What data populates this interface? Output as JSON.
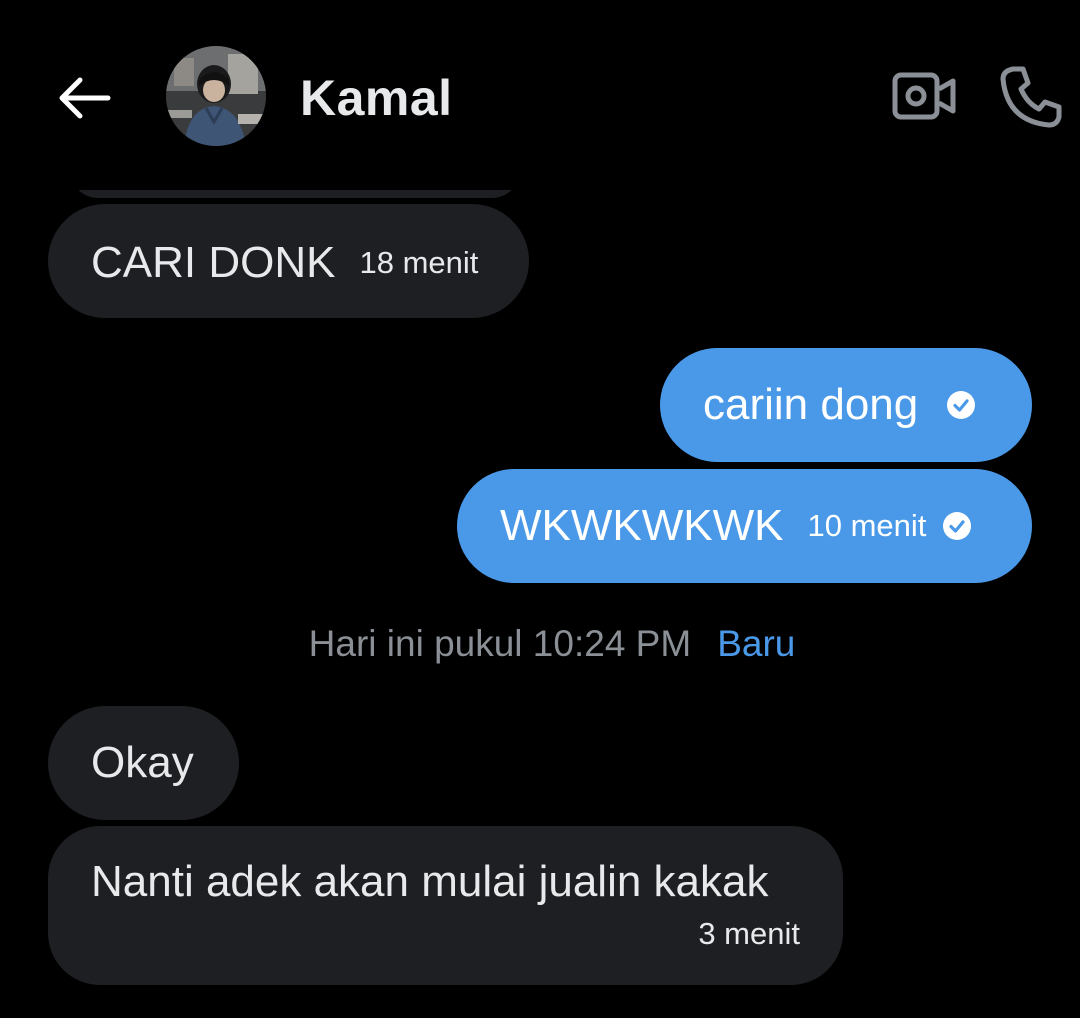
{
  "header": {
    "contact_name": "Kamal",
    "back_icon": "arrow-left-icon",
    "video_icon": "video-camera-icon",
    "call_icon": "phone-icon"
  },
  "messages": [
    {
      "direction": "incoming",
      "text": "CARI DONK",
      "time": "18 menit"
    },
    {
      "direction": "outgoing",
      "text": "cariin dong",
      "time": "",
      "status": "read-check-icon"
    },
    {
      "direction": "outgoing",
      "text": "WKWKWKWK",
      "time": "10 menit",
      "status": "read-check-icon"
    },
    {
      "direction": "incoming",
      "text": "Okay",
      "time": ""
    },
    {
      "direction": "incoming",
      "text": "Nanti adek akan mulai jualin kakak",
      "time": "3 menit"
    }
  ],
  "divider": {
    "text": "Hari ini pukul 10:24 PM",
    "new_label": "Baru"
  },
  "colors": {
    "background": "#000000",
    "incoming_bubble": "#1d1f23",
    "outgoing_bubble": "#4a99e9",
    "accent": "#4a99e9",
    "muted_text": "#8b9096"
  }
}
